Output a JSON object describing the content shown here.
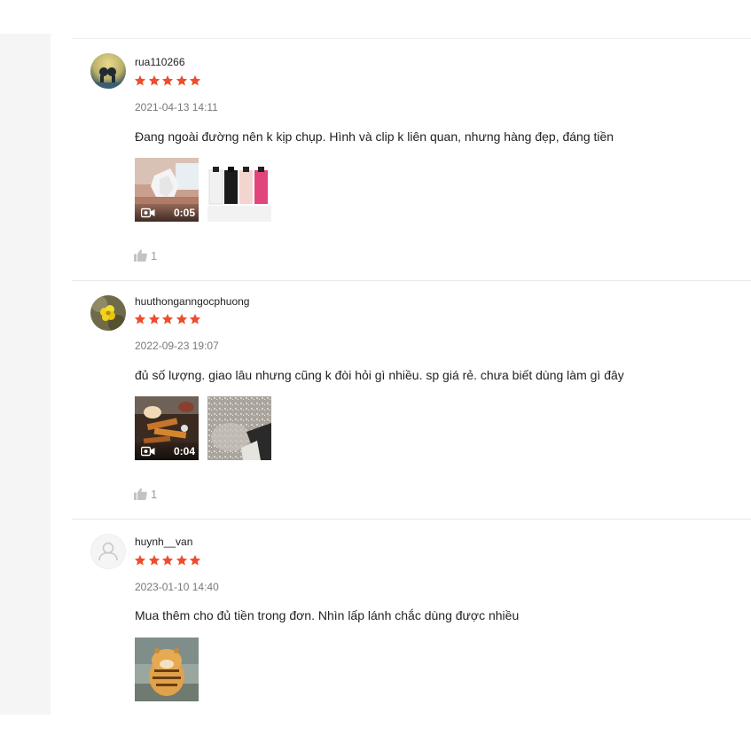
{
  "colors": {
    "star": "#ee4d2d",
    "muted": "#9b9b9b",
    "divider": "#e8e8e8"
  },
  "reviews": [
    {
      "username": "rua110266",
      "rating": 5,
      "timestamp": "2021-04-13 14:11",
      "comment": "Đang ngoài đường nên k kịp chụp. Hình và clip k liên quan, nhưng hàng đẹp, đáng tiền",
      "video_duration": "0:05",
      "likes": "1"
    },
    {
      "username": "huuthonganngocphuong",
      "rating": 5,
      "timestamp": "2022-09-23 19:07",
      "comment": "đủ số lượng. giao lâu nhưng cũng k đòi hỏi gì nhiều. sp giá rẻ. chưa biết dùng làm gì đây",
      "video_duration": "0:04",
      "likes": "1"
    },
    {
      "username": "huynh__van",
      "rating": 5,
      "timestamp": "2023-01-10 14:40",
      "comment": "Mua thêm cho đủ tiền trong đơn. Nhìn lấp lánh chắc dùng được nhiều"
    }
  ]
}
